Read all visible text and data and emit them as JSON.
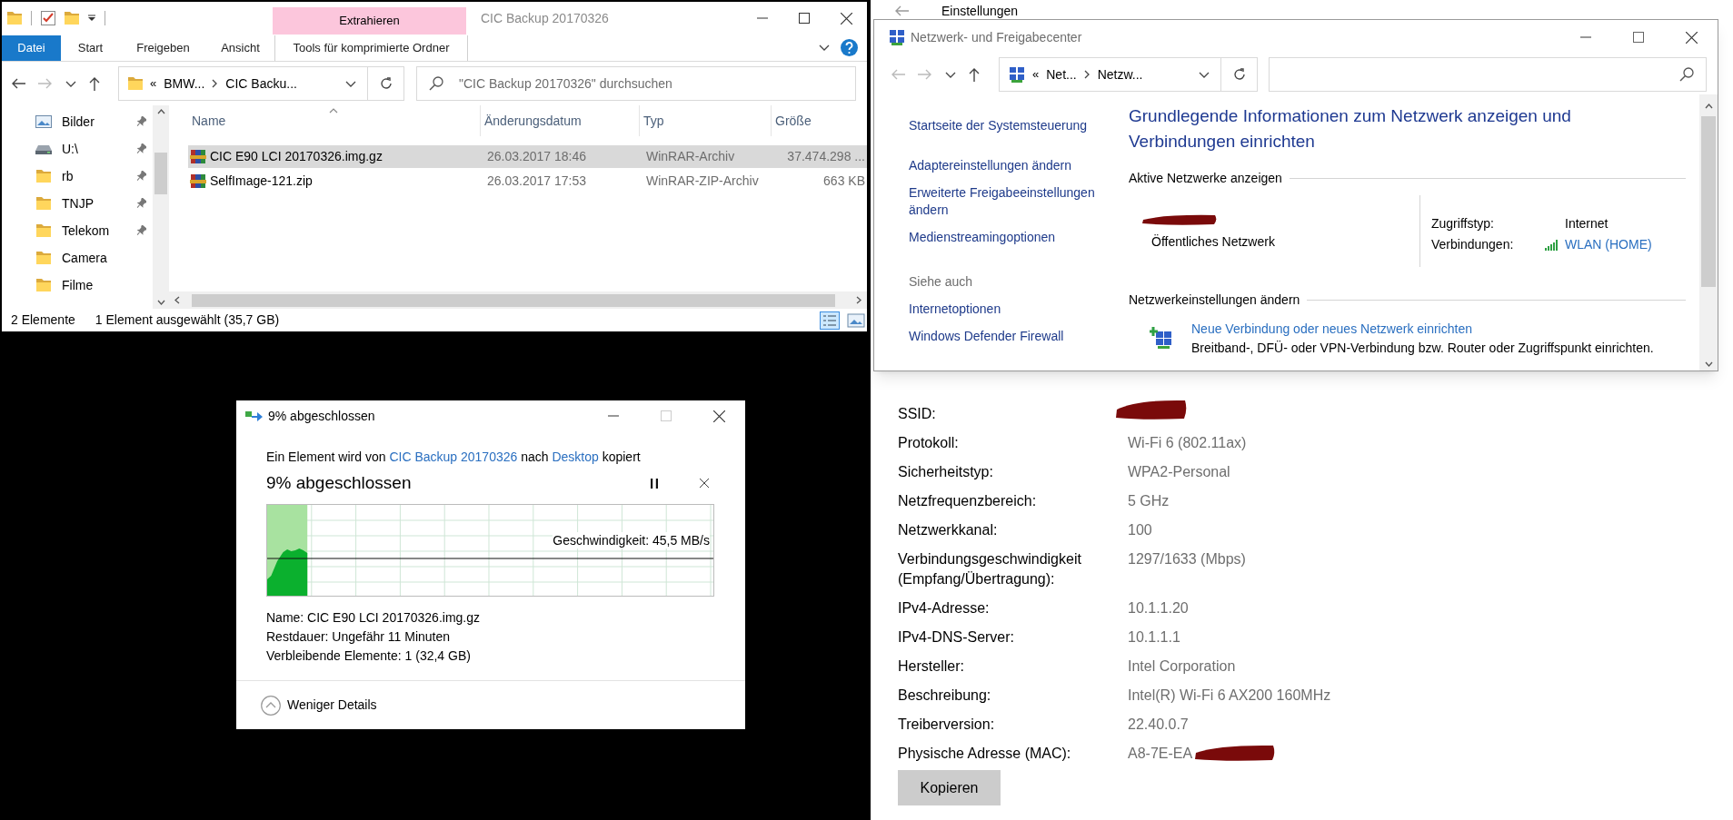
{
  "explorer": {
    "title": "CIC Backup 20170326",
    "context_tab": "Extrahieren",
    "ribbon_tabs": [
      {
        "label": "Datei",
        "kind": "file"
      },
      {
        "label": "Start",
        "kind": "tab"
      },
      {
        "label": "Freigeben",
        "kind": "tab"
      },
      {
        "label": "Ansicht",
        "kind": "tab"
      },
      {
        "label": "Tools für komprimierte Ordner",
        "kind": "context"
      }
    ],
    "address": {
      "overflow": "«",
      "segments": [
        "BMW...",
        "CIC Backu..."
      ]
    },
    "search": {
      "placeholder": "\"CIC Backup 20170326\" durchsuchen"
    },
    "nav_items": [
      {
        "label": "Bilder",
        "kind": "pictures",
        "pinned": true
      },
      {
        "label": "U:\\",
        "kind": "drive",
        "pinned": true
      },
      {
        "label": "rb",
        "kind": "folder",
        "pinned": true
      },
      {
        "label": "TNJP",
        "kind": "folder",
        "pinned": true
      },
      {
        "label": "Telekom",
        "kind": "folder",
        "pinned": true
      },
      {
        "label": "Camera",
        "kind": "folder",
        "pinned": false
      },
      {
        "label": "Filme",
        "kind": "folder",
        "pinned": false
      }
    ],
    "columns": [
      "Name",
      "Änderungsdatum",
      "Typ",
      "Größe"
    ],
    "rows": [
      {
        "name": "CIC E90 LCI 20170326.img.gz",
        "modified": "26.03.2017 18:46",
        "type": "WinRAR-Archiv",
        "size": "37.474.298 ...",
        "selected": true
      },
      {
        "name": "SelfImage-121.zip",
        "modified": "26.03.2017 17:53",
        "type": "WinRAR-ZIP-Archiv",
        "size": "663 KB",
        "selected": false
      }
    ],
    "status_bar": {
      "count": "2 Elemente",
      "selection": "1 Element ausgewählt (35,7 GB)"
    }
  },
  "copy_dialog": {
    "title": "9% abgeschlossen",
    "message": [
      {
        "text": "Ein Element wird von ",
        "link": false
      },
      {
        "text": "CIC Backup 20170326",
        "link": true
      },
      {
        "text": " nach ",
        "link": false
      },
      {
        "text": "Desktop",
        "link": true
      },
      {
        "text": " kopiert",
        "link": false
      }
    ],
    "heading": "9% abgeschlossen",
    "progress": {
      "level": 0.09
    },
    "speed": "Geschwindigkeit: 45,5 MB/s",
    "details": [
      {
        "label": "Name:",
        "value": "CIC E90 LCI 20170326.img.gz"
      },
      {
        "label": "Restdauer:",
        "value": "Ungefähr 11 Minuten"
      },
      {
        "label": "Verbleibende Elemente:",
        "value": "1 (32,4 GB)"
      }
    ],
    "toggle": "Weniger Details"
  },
  "network_center": {
    "title": "Netzwerk- und Freigabecenter",
    "address": {
      "overflow": "«",
      "segments": [
        "Net...",
        "Netzw..."
      ]
    },
    "tasks": [
      {
        "label": "Startseite der Systemsteuerung",
        "kind": "link"
      },
      {
        "label": "Adaptereinstellungen ändern",
        "kind": "link"
      },
      {
        "label": "Erweiterte Freigabeeinstellungen ändern",
        "kind": "link"
      },
      {
        "label": "Medienstreamingoptionen",
        "kind": "link"
      },
      {
        "label": "Siehe auch",
        "kind": "header"
      },
      {
        "label": "Internetoptionen",
        "kind": "link"
      },
      {
        "label": "Windows Defender Firewall",
        "kind": "link"
      }
    ],
    "heading": "Grundlegende Informationen zum Netzwerk anzeigen und Verbindungen einrichten",
    "active_section": "Aktive Netzwerke anzeigen",
    "network": {
      "name_redacted": true,
      "category": "Öffentliches Netzwerk"
    },
    "access_type_label": "Zugriffstyp:",
    "access_type": "Internet",
    "connections_label": "Verbindungen:",
    "connection": "WLAN (HOME)",
    "change_section": "Netzwerkeinstellungen ändern",
    "actions": [
      {
        "title": "Neue Verbindung oder neues Netzwerk einrichten",
        "description": "Breitband-, DFÜ- oder VPN-Verbindung bzw. Router oder Zugriffspunkt einrichten."
      }
    ]
  },
  "settings": {
    "title": "Einstellungen",
    "properties": [
      {
        "label": "SSID:",
        "redacted": true
      },
      {
        "label": "Protokoll:",
        "value": "Wi-Fi 6 (802.11ax)"
      },
      {
        "label": "Sicherheitstyp:",
        "value": "WPA2-Personal"
      },
      {
        "label": "Netzfrequenzbereich:",
        "value": "5 GHz"
      },
      {
        "label": "Netzwerkkanal:",
        "value": "100"
      },
      {
        "label": "Verbindungsgeschwindigkeit (Empfang/Übertragung):",
        "value": "1297/1633 (Mbps)"
      },
      {
        "label": "IPv4-Adresse:",
        "value": "10.1.1.20"
      },
      {
        "label": "IPv4-DNS-Server:",
        "value": "10.1.1.1"
      },
      {
        "label": "Hersteller:",
        "value": "Intel Corporation"
      },
      {
        "label": "Beschreibung:",
        "value": "Intel(R) Wi-Fi 6 AX200 160MHz"
      },
      {
        "label": "Treiberversion:",
        "value": "22.40.0.7"
      },
      {
        "label": "Physische Adresse (MAC):",
        "value": "A8-7E-EA",
        "redacted": true
      }
    ],
    "copy_button": "Kopieren"
  }
}
